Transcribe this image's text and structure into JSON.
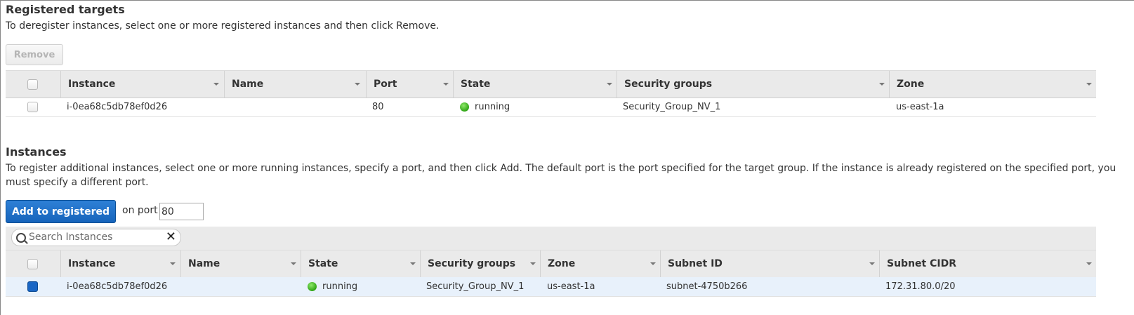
{
  "registered": {
    "title": "Registered targets",
    "description": "To deregister instances, select one or more registered instances and then click Remove.",
    "remove_label": "Remove",
    "columns": [
      "Instance",
      "Name",
      "Port",
      "State",
      "Security groups",
      "Zone"
    ],
    "rows": [
      {
        "instance": "i-0ea68c5db78ef0d26",
        "name": "",
        "port": "80",
        "state": "running",
        "security_groups": "Security_Group_NV_1",
        "zone": "us-east-1a"
      }
    ]
  },
  "instances": {
    "title": "Instances",
    "description_line1": "To register additional instances, select one or more running instances, specify a port, and then click Add. The default port is the port specified for the target group. If the instance is already registered on the specified port, you",
    "description_line2": "must specify a different port.",
    "add_label": "Add to registered",
    "on_port_label": "on port",
    "port_value": "80",
    "search_placeholder": "Search Instances",
    "columns": [
      "Instance",
      "Name",
      "State",
      "Security groups",
      "Zone",
      "Subnet ID",
      "Subnet CIDR"
    ],
    "rows": [
      {
        "selected": true,
        "instance": "i-0ea68c5db78ef0d26",
        "name": "",
        "state": "running",
        "security_groups": "Security_Group_NV_1",
        "zone": "us-east-1a",
        "subnet_id": "subnet-4750b266",
        "subnet_cidr": "172.31.80.0/20"
      }
    ]
  },
  "colors": {
    "primary": "#1a66c4",
    "running": "#2fa515",
    "header_bg": "#eaeaea",
    "selected_row": "#e8f1fb"
  }
}
